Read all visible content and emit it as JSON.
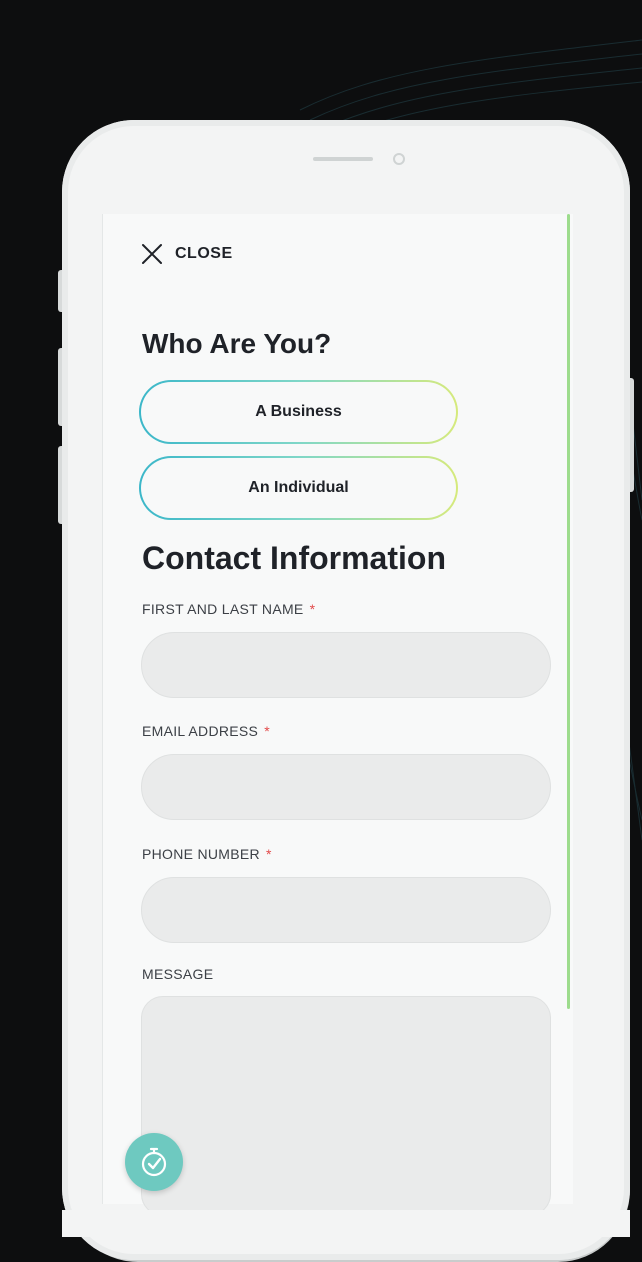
{
  "close": {
    "label": "CLOSE"
  },
  "who": {
    "title": "Who Are You?",
    "options": [
      {
        "label": "A Business"
      },
      {
        "label": "An Individual"
      }
    ]
  },
  "contact": {
    "title": "Contact Information",
    "fields": [
      {
        "label": "FIRST AND LAST NAME",
        "required": "*",
        "value": "",
        "placeholder": ""
      },
      {
        "label": "EMAIL ADDRESS",
        "required": "*",
        "value": "",
        "placeholder": ""
      },
      {
        "label": "PHONE NUMBER",
        "required": "*",
        "value": "",
        "placeholder": ""
      },
      {
        "label": "MESSAGE",
        "value": "",
        "placeholder": ""
      }
    ]
  },
  "colors": {
    "background": "#0d0e0f",
    "phone_body": "#f3f4f4",
    "accent_teal": "#3bb7c9",
    "accent_lime": "#d6ea7c",
    "scroll_indicator": "#9ddc8d",
    "required_mark": "#e24a4a",
    "fab": "#6ec9c0"
  },
  "icons": {
    "close": "close-x-icon",
    "fab": "stopwatch-check-icon"
  }
}
